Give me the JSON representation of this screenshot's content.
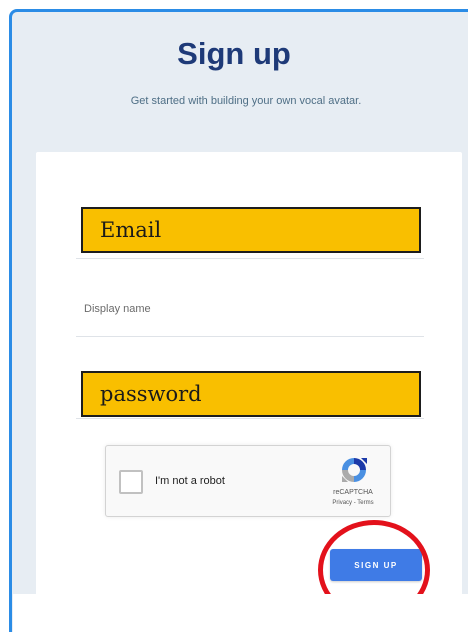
{
  "page": {
    "title": "Sign up",
    "subtitle": "Get started with building your own vocal avatar."
  },
  "form": {
    "email_overlay_label": "Email",
    "display_name_placeholder": "Display name",
    "display_name_value": "",
    "password_overlay_label": "password"
  },
  "recaptcha": {
    "checkbox_label": "I'm not a robot",
    "checked": false,
    "brand": "reCAPTCHA",
    "links": "Privacy - Terms",
    "icon": "recaptcha-logo-icon"
  },
  "actions": {
    "signup_label": "SIGN UP"
  },
  "annotation": {
    "highlight": "red-circle"
  },
  "colors": {
    "frame_border": "#2b8ce6",
    "header_bg": "#e7edf3",
    "title": "#1e3a78",
    "redaction": "#f9bf00",
    "button": "#3f7be6",
    "annotation": "#e3111b"
  }
}
